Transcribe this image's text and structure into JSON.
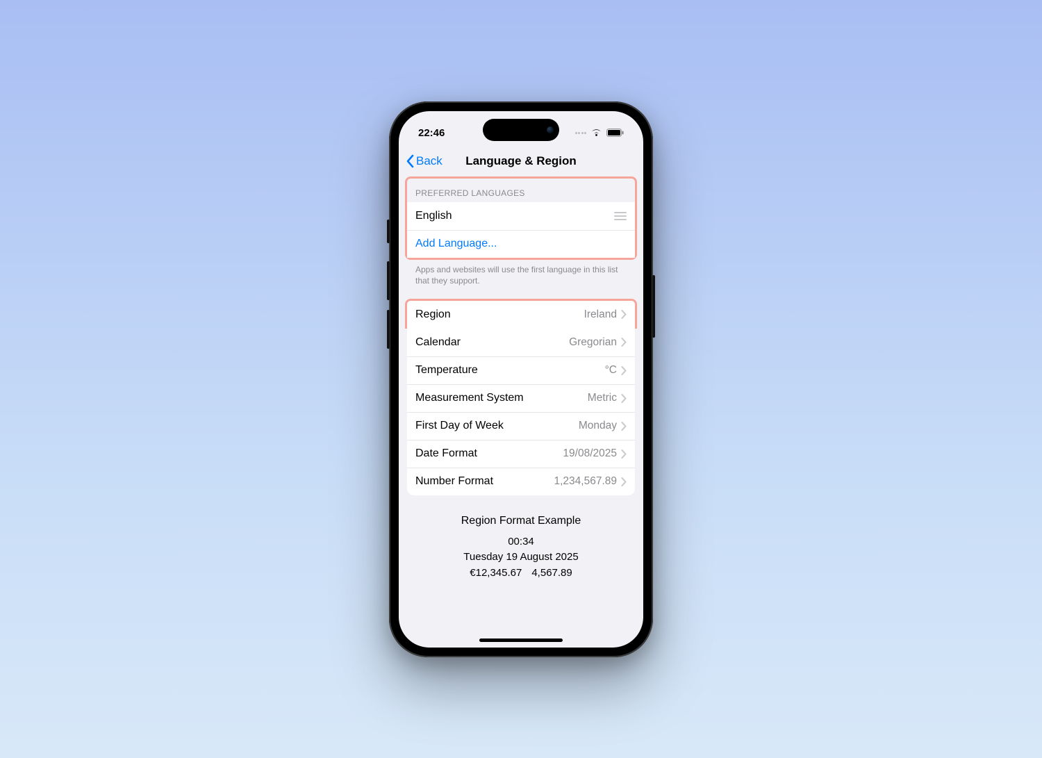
{
  "status": {
    "time": "22:46"
  },
  "nav": {
    "back_label": "Back",
    "title": "Language & Region"
  },
  "languages": {
    "header": "PREFERRED LANGUAGES",
    "items": [
      {
        "name": "English"
      }
    ],
    "add_label": "Add Language...",
    "footer": "Apps and websites will use the first language in this list that they support."
  },
  "settings": [
    {
      "label": "Region",
      "value": "Ireland",
      "highlighted": true
    },
    {
      "label": "Calendar",
      "value": "Gregorian"
    },
    {
      "label": "Temperature",
      "value": "°C"
    },
    {
      "label": "Measurement System",
      "value": "Metric"
    },
    {
      "label": "First Day of Week",
      "value": "Monday"
    },
    {
      "label": "Date Format",
      "value": "19/08/2025"
    },
    {
      "label": "Number Format",
      "value": "1,234,567.89"
    }
  ],
  "example": {
    "title": "Region Format Example",
    "time": "00:34",
    "date": "Tuesday 19 August 2025",
    "currency": "€12,345.67",
    "number": "4,567.89"
  }
}
